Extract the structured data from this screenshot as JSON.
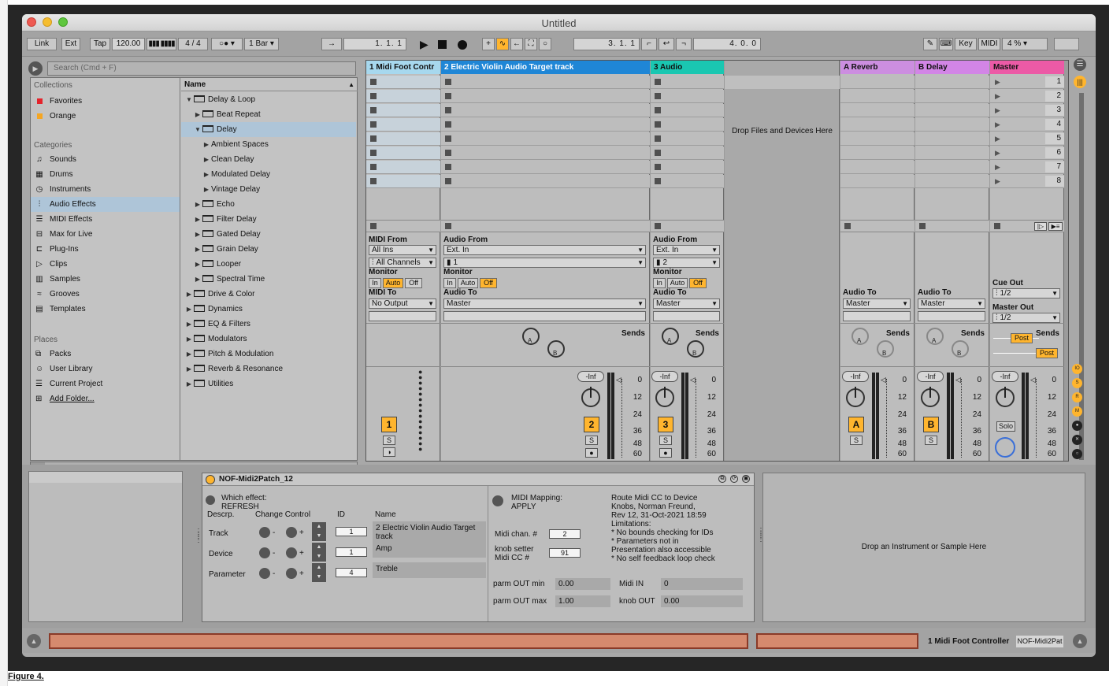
{
  "window": {
    "title": "Untitled"
  },
  "control_bar": {
    "link": "Link",
    "ext": "Ext",
    "tap": "Tap",
    "tempo": "120.00",
    "signature": "4 / 4",
    "quantize": "1 Bar",
    "arrangement_position": "1.  1.  1",
    "loop_start": "3.  1.  1",
    "loop_length": "4.  0.  0",
    "key": "Key",
    "midi": "MIDI",
    "cpu": "4 %"
  },
  "browser": {
    "search_placeholder": "Search (Cmd + F)",
    "collections_header": "Collections",
    "collections": [
      {
        "label": "Favorites",
        "color": "#e4232b"
      },
      {
        "label": "Orange",
        "color": "#f5a623"
      }
    ],
    "categories_header": "Categories",
    "categories": [
      {
        "label": "Sounds",
        "icon": "note-icon"
      },
      {
        "label": "Drums",
        "icon": "grid-icon"
      },
      {
        "label": "Instruments",
        "icon": "clock-icon"
      },
      {
        "label": "Audio Effects",
        "icon": "waveform-icon"
      },
      {
        "label": "MIDI Effects",
        "icon": "midi-icon"
      },
      {
        "label": "Max for Live",
        "icon": "max-icon"
      },
      {
        "label": "Plug-Ins",
        "icon": "plug-icon"
      },
      {
        "label": "Clips",
        "icon": "clip-icon"
      },
      {
        "label": "Samples",
        "icon": "sample-icon"
      },
      {
        "label": "Grooves",
        "icon": "groove-icon"
      },
      {
        "label": "Templates",
        "icon": "template-icon"
      }
    ],
    "selected_category": "Audio Effects",
    "places_header": "Places",
    "places": [
      {
        "label": "Packs"
      },
      {
        "label": "User Library"
      },
      {
        "label": "Current Project"
      },
      {
        "label": "Add Folder..."
      }
    ],
    "name_header": "Name",
    "tree": [
      {
        "label": "Delay & Loop",
        "depth": 0,
        "expanded": true
      },
      {
        "label": "Beat Repeat",
        "depth": 1,
        "expanded": false
      },
      {
        "label": "Delay",
        "depth": 1,
        "expanded": true,
        "selected": true
      },
      {
        "label": "Ambient Spaces",
        "depth": 2,
        "expanded": false
      },
      {
        "label": "Clean Delay",
        "depth": 2,
        "expanded": false
      },
      {
        "label": "Modulated Delay",
        "depth": 2,
        "expanded": false
      },
      {
        "label": "Vintage Delay",
        "depth": 2,
        "expanded": false
      },
      {
        "label": "Echo",
        "depth": 1,
        "expanded": false
      },
      {
        "label": "Filter Delay",
        "depth": 1,
        "expanded": false
      },
      {
        "label": "Gated Delay",
        "depth": 1,
        "expanded": false
      },
      {
        "label": "Grain Delay",
        "depth": 1,
        "expanded": false
      },
      {
        "label": "Looper",
        "depth": 1,
        "expanded": false
      },
      {
        "label": "Spectral Time",
        "depth": 1,
        "expanded": false
      },
      {
        "label": "Drive & Color",
        "depth": 0,
        "expanded": false
      },
      {
        "label": "Dynamics",
        "depth": 0,
        "expanded": false
      },
      {
        "label": "EQ & Filters",
        "depth": 0,
        "expanded": false
      },
      {
        "label": "Modulators",
        "depth": 0,
        "expanded": false
      },
      {
        "label": "Pitch & Modulation",
        "depth": 0,
        "expanded": false
      },
      {
        "label": "Reverb & Resonance",
        "depth": 0,
        "expanded": false
      },
      {
        "label": "Utilities",
        "depth": 0,
        "expanded": false
      }
    ]
  },
  "tracks": {
    "t1": {
      "name": "1 Midi Foot Contr",
      "color": "#a7d8ee",
      "midi_from_label": "MIDI From",
      "midi_from": "All Ins",
      "channel": "All Channels",
      "monitor_label": "Monitor",
      "monitor": [
        "In",
        "Auto",
        "Off"
      ],
      "monitor_active": "Auto",
      "midi_to_label": "MIDI To",
      "midi_to": "No Output",
      "number": "1",
      "solo": "S"
    },
    "t2": {
      "name": "2 Electric Violin Audio Target track",
      "color": "#1f86d6",
      "audio_from_label": "Audio From",
      "audio_from": "Ext. In",
      "channel": "1",
      "monitor_label": "Monitor",
      "monitor": [
        "In",
        "Auto",
        "Off"
      ],
      "monitor_active": "Off",
      "audio_to_label": "Audio To",
      "audio_to": "Master",
      "sends": "Sends",
      "volume": "-Inf",
      "number": "2",
      "solo": "S"
    },
    "t3": {
      "name": "3 Audio",
      "color": "#1ac7b1",
      "audio_from_label": "Audio From",
      "audio_from": "Ext. In",
      "channel": "2",
      "monitor_label": "Monitor",
      "monitor": [
        "In",
        "Auto",
        "Off"
      ],
      "monitor_active": "Off",
      "audio_to_label": "Audio To",
      "audio_to": "Master",
      "sends": "Sends",
      "volume": "-Inf",
      "number": "3",
      "solo": "S"
    },
    "drop_zone": "Drop Files and Devices Here",
    "ra": {
      "name": "A Reverb",
      "color": "#cc8ee0",
      "audio_to_label": "Audio To",
      "audio_to": "Master",
      "sends": "Sends",
      "volume": "-Inf",
      "number": "A",
      "solo": "S"
    },
    "rb": {
      "name": "B Delay",
      "color": "#d285e6",
      "audio_to_label": "Audio To",
      "audio_to": "Master",
      "sends": "Sends",
      "volume": "-Inf",
      "number": "B",
      "solo": "S"
    },
    "master": {
      "name": "Master",
      "color": "#ec5aa6",
      "cue_out_label": "Cue Out",
      "cue_out": "1/2",
      "master_out_label": "Master Out",
      "master_out": "1/2",
      "sends": "Sends",
      "post": "Post",
      "volume": "-Inf",
      "solo": "Solo",
      "scenes": [
        "1",
        "2",
        "3",
        "4",
        "5",
        "6",
        "7",
        "8"
      ]
    },
    "knob_a": "A",
    "knob_b": "B",
    "meter_scale": [
      "0",
      "12",
      "24",
      "36",
      "48",
      "60"
    ]
  },
  "device": {
    "name": "NOF-Midi2Patch_12",
    "which_effect_label": "Which effect:",
    "which_effect_value": "REFRESH",
    "headers": {
      "descr": "Descrp.",
      "change": "Change Control",
      "id": "ID",
      "name": "Name"
    },
    "rows": [
      {
        "descr": "Track",
        "id": "1",
        "name": "2 Electric Violin Audio Target track"
      },
      {
        "descr": "Device",
        "id": "1",
        "name": "Amp"
      },
      {
        "descr": "Parameter",
        "id": "4",
        "name": "Treble"
      }
    ],
    "minus": "-",
    "plus": "+",
    "midi_mapping_label": "MIDI Mapping:",
    "midi_mapping_value": "APPLY",
    "midi_chan_label": "Midi chan. #",
    "midi_chan": "2",
    "knob_setter_label1": "knob setter",
    "knob_setter_label2": "Midi CC #",
    "knob_setter": "91",
    "info": [
      "Route Midi CC to Device",
      "Knobs, Norman Freund,",
      "Rev 12, 31-Oct-2021 18:59",
      "Limitations:",
      "* No bounds checking for IDs",
      "* Parameters not in",
      "Presentation also accessible",
      "* No self feedback loop check"
    ],
    "parm_out_min_label": "parm OUT min",
    "parm_out_min": "0.00",
    "parm_out_max_label": "parm OUT max",
    "parm_out_max": "1.00",
    "midi_in_label": "Midi IN",
    "midi_in": "0",
    "knob_out_label": "knob OUT",
    "knob_out": "0.00",
    "drop_instrument": "Drop an Instrument or Sample Here"
  },
  "status": {
    "track": "1 Midi Foot Controller",
    "device": "NOF-Midi2Pat"
  },
  "figure_caption": "Figure 4."
}
